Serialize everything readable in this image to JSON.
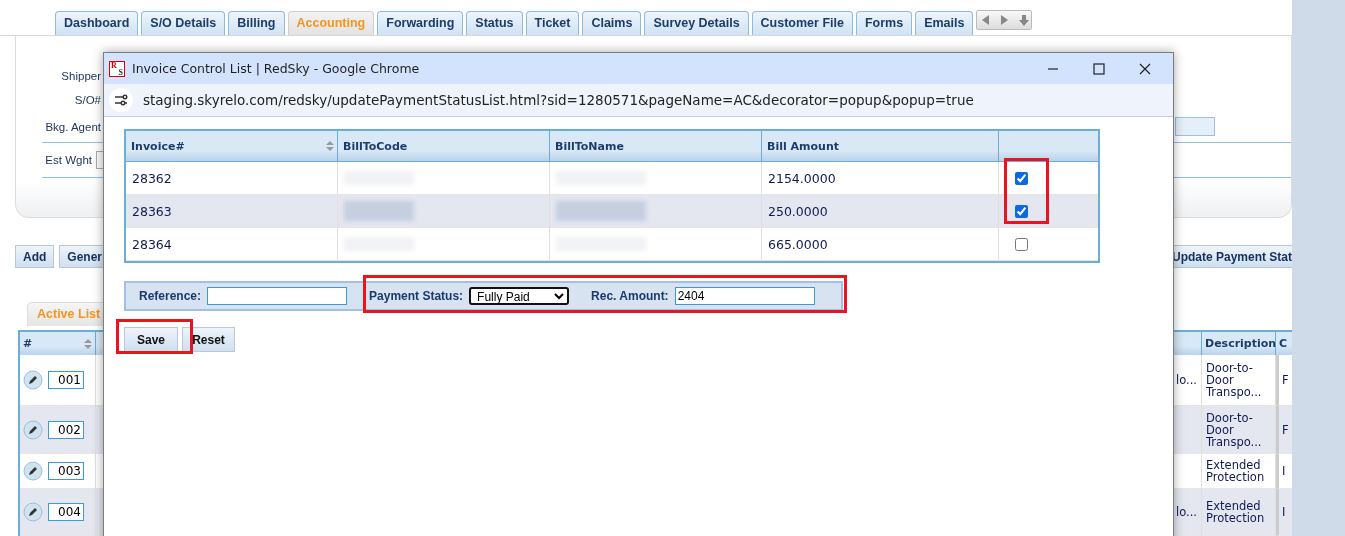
{
  "tabs": [
    {
      "label": "Dashboard",
      "selected": false
    },
    {
      "label": "S/O Details",
      "selected": false
    },
    {
      "label": "Billing",
      "selected": false
    },
    {
      "label": "Accounting",
      "selected": true
    },
    {
      "label": "Forwarding",
      "selected": false
    },
    {
      "label": "Status",
      "selected": false
    },
    {
      "label": "Ticket",
      "selected": false
    },
    {
      "label": "Claims",
      "selected": false
    },
    {
      "label": "Survey Details",
      "selected": false
    },
    {
      "label": "Customer File",
      "selected": false
    },
    {
      "label": "Forms",
      "selected": false
    },
    {
      "label": "Emails",
      "selected": false
    }
  ],
  "shipment_form": {
    "fields": [
      {
        "label": "Shipper"
      },
      {
        "label": "S/O#"
      },
      {
        "label": "Bkg. Agent"
      },
      {
        "label": "Est Wght"
      }
    ]
  },
  "action_buttons": [
    "Add",
    "Gener",
    "Update Payment Stat"
  ],
  "list_tabs": [
    {
      "label": "Active List",
      "selected": true
    }
  ],
  "list_table": {
    "columns": [
      "#",
      "",
      "",
      "Description",
      "C"
    ],
    "rows": [
      {
        "number": "001",
        "column_3": "lo...",
        "description": "Door-to-Door Transpo...",
        "column_5": "F"
      },
      {
        "number": "002",
        "column_3": "",
        "description": "Door-to-Door Transpo...",
        "column_5": "F"
      },
      {
        "number": "003",
        "column_3": "",
        "description": "Extended Protection",
        "column_5": "I"
      },
      {
        "number": "004",
        "column_3": "lo...",
        "description": "Extended Protection",
        "column_5": "I"
      }
    ]
  },
  "popup": {
    "favicon": [
      "R",
      "S"
    ],
    "title": "Invoice Control List | RedSky - Google Chrome",
    "url": "staging.skyrelo.com/redsky/updatePaymentStatusList.html?sid=1280571&pageName=AC&decorator=popup&popup=true",
    "table": {
      "columns": [
        "Invoice#",
        "BillToCode",
        "BillToName",
        "Bill Amount"
      ],
      "rows": [
        {
          "invoice": "28362",
          "bill_amount": "2154.0000",
          "checked": true
        },
        {
          "invoice": "28363",
          "bill_amount": "250.0000",
          "checked": true
        },
        {
          "invoice": "28364",
          "bill_amount": "665.0000",
          "checked": false
        }
      ]
    },
    "form": {
      "reference_label": "Reference:",
      "payment_status_label": "Payment Status:",
      "payment_status": "Fully Paid",
      "rec_amount_label": "Rec. Amount:",
      "rec_amount": "2404"
    },
    "buttons": [
      "Save",
      "Reset"
    ]
  },
  "annotations": [
    {
      "kind": "frame"
    },
    {
      "kind": "frame"
    },
    {
      "kind": "frame"
    }
  ]
}
